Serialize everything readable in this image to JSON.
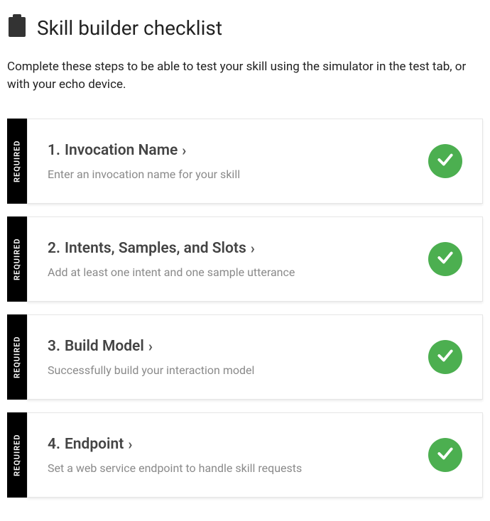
{
  "header": {
    "title": "Skill builder checklist"
  },
  "intro": "Complete these steps to be able to test your skill using the simulator in the test tab, or with your echo device.",
  "required_label": "REQUIRED",
  "status_complete_color": "#4CAF50",
  "items": [
    {
      "number": "1.",
      "title": "Invocation Name",
      "description": "Enter an invocation name for your skill",
      "status": "complete"
    },
    {
      "number": "2.",
      "title": "Intents, Samples, and Slots",
      "description": "Add at least one intent and one sample utterance",
      "status": "complete"
    },
    {
      "number": "3.",
      "title": "Build Model",
      "description": "Successfully build your interaction model",
      "status": "complete"
    },
    {
      "number": "4.",
      "title": "Endpoint",
      "description": "Set a web service endpoint to handle skill requests",
      "status": "complete"
    }
  ]
}
